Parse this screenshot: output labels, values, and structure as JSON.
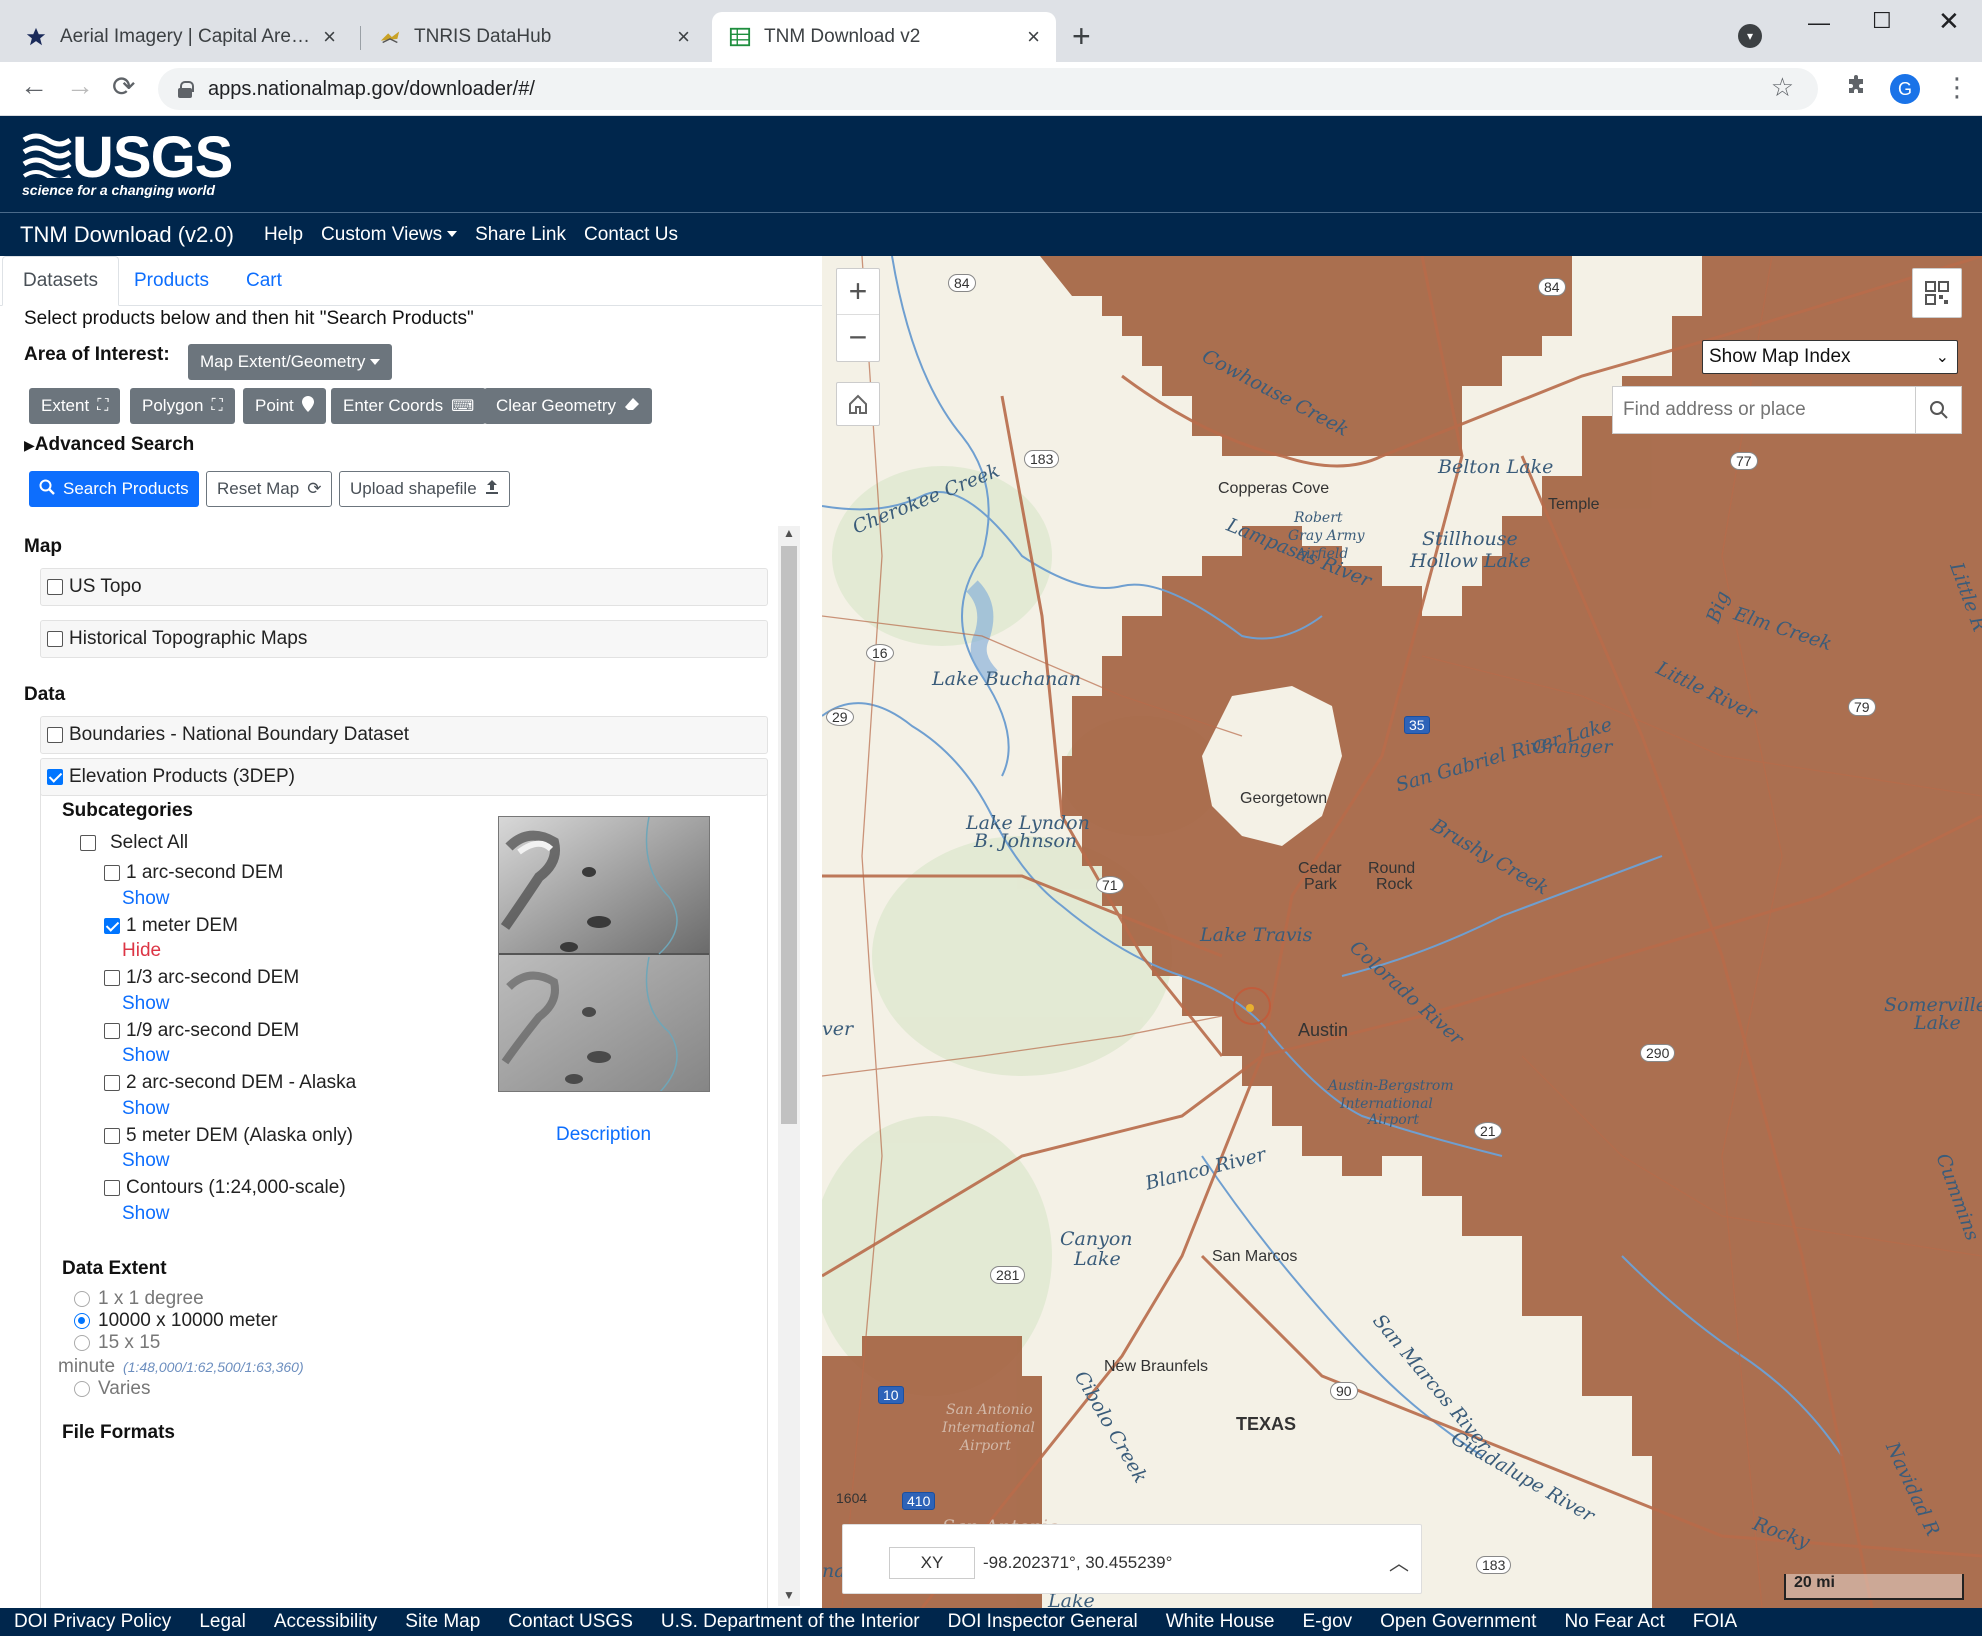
{
  "browser": {
    "tabs": [
      {
        "title": "Aerial Imagery | Capital Area Cou",
        "icon": "star-icon"
      },
      {
        "title": "TNRIS DataHub",
        "icon": "tnris-icon"
      },
      {
        "title": "TNM Download v2",
        "icon": "tnm-icon"
      }
    ],
    "new_tab": "+",
    "url": "apps.nationalmap.gov/downloader/#/",
    "profile_initial": "G"
  },
  "usgs": {
    "logo_word": "USGS",
    "tagline": "science for a changing world"
  },
  "nav": {
    "brand": "TNM Download (v2.0)",
    "links": [
      "Help",
      "Custom Views",
      "Share Link",
      "Contact Us"
    ]
  },
  "panel": {
    "tabs": [
      "Datasets",
      "Products",
      "Cart"
    ],
    "instruction": "Select products below and then hit \"Search Products\"",
    "aoi_label": "Area of Interest:",
    "aoi_dropdown": "Map Extent/Geometry",
    "geo_buttons": [
      "Extent",
      "Polygon",
      "Point",
      "Enter Coords",
      "Clear Geometry"
    ],
    "advanced_search": "Advanced Search",
    "search_button": "Search Products",
    "reset_button": "Reset Map",
    "upload_button": "Upload shapefile",
    "sections": {
      "map": "Map",
      "data": "Data",
      "subcategories": "Subcategories",
      "data_extent": "Data Extent",
      "file_formats": "File Formats"
    },
    "map_items": [
      {
        "label": "US Topo",
        "checked": false
      },
      {
        "label": "Historical Topographic Maps",
        "checked": false
      }
    ],
    "data_items": [
      {
        "label": "Boundaries - National Boundary Dataset",
        "checked": false
      },
      {
        "label": "Elevation Products (3DEP)",
        "checked": true
      }
    ],
    "select_all": "Select All",
    "subcategory_items": [
      {
        "label": "1 arc-second DEM",
        "checked": false,
        "toggle": "Show"
      },
      {
        "label": "1 meter DEM",
        "checked": true,
        "toggle": "Hide"
      },
      {
        "label": "1/3 arc-second DEM",
        "checked": false,
        "toggle": "Show"
      },
      {
        "label": "1/9 arc-second DEM",
        "checked": false,
        "toggle": "Show"
      },
      {
        "label": "2 arc-second DEM - Alaska",
        "checked": false,
        "toggle": "Show"
      },
      {
        "label": "5 meter DEM (Alaska only)",
        "checked": false,
        "toggle": "Show"
      },
      {
        "label": "Contours (1:24,000-scale)",
        "checked": false,
        "toggle": "Show"
      }
    ],
    "description_link": "Description",
    "extent_options": [
      {
        "label": "1 x 1 degree",
        "selected": false,
        "enabled": false
      },
      {
        "label": "10000 x 10000 meter",
        "selected": true,
        "enabled": true
      },
      {
        "label": "15 x 15",
        "selected": false,
        "enabled": false
      },
      {
        "label": "Varies",
        "selected": false,
        "enabled": false
      }
    ],
    "extent_minute": "minute",
    "extent_scale_note": "(1:48,000/1:62,500/1:63,360)"
  },
  "map": {
    "index_select": "Show Map Index",
    "search_placeholder": "Find address or place",
    "coord_mode": "XY",
    "coordinates": "-98.202371°, 30.455239°",
    "scale": "20 mi",
    "labels": {
      "cowhouse": "Cowhouse Creek",
      "belton": "Belton Lake",
      "copperas": "Copperas Cove",
      "temple": "Temple",
      "robert": "Robert",
      "gray_army": "Gray Army",
      "airfield": "Airfield",
      "stillhouse": "Stillhouse",
      "hollow": "Hollow Lake",
      "lampasas": "Lampasas River",
      "cherokee": "Cherokee Creek",
      "buchanan": "Lake Buchanan",
      "elm": "Elm Creek",
      "little_river": "Little River",
      "big": "Big",
      "little_r": "Little R",
      "granger": "Granger",
      "sangabriel": "San Gabriel River Lake",
      "georgetown": "Georgetown",
      "lyndon1": "Lake Lyndon",
      "lyndon2": "B. Johnson",
      "cedar1": "Cedar",
      "cedar2": "Park",
      "round1": "Round",
      "round2": "Rock",
      "brushy": "Brushy Creek",
      "travis": "Lake Travis",
      "colorado": "Colorado River",
      "austin": "Austin",
      "somerville1": "Somerville",
      "somerville2": "Lake",
      "bergstrom1": "Austin-Bergstrom",
      "bergstrom2": "International",
      "bergstrom3": "Airport",
      "blanco": "Blanco River",
      "canyon1": "Canyon",
      "canyon2": "Lake",
      "sanmarcos": "San Marcos",
      "cummins": "Cummins",
      "newbraunfels": "New Braunfels",
      "sanmarcos_river": "San Marcos River",
      "sa1": "San Antonio",
      "sa2": "International",
      "sa3": "Airport",
      "cibolo": "Cibolo Creek",
      "texas": "TEXAS",
      "guadalupe": "Guadalupe River",
      "rocky": "Rocky",
      "navidad": "Navidad R",
      "sanantonio": "San Antonio",
      "ver": "ver",
      "na": "na",
      "lake_b": "Lake"
    },
    "highway_shields": [
      "84",
      "84",
      "183",
      "77",
      "16",
      "35",
      "79",
      "29",
      "71",
      "290",
      "21",
      "281",
      "90",
      "10",
      "410",
      "183",
      "1604"
    ]
  },
  "footer": {
    "links": [
      "DOI Privacy Policy",
      "Legal",
      "Accessibility",
      "Site Map",
      "Contact USGS",
      "U.S. Department of the Interior",
      "DOI Inspector General",
      "White House",
      "E-gov",
      "Open Government",
      "No Fear Act",
      "FOIA"
    ]
  },
  "colors": {
    "usgs_navy": "#00264c",
    "coverage_brown": "#a3613f",
    "primary_blue": "#0d6efd",
    "hide_red": "#dc3545"
  }
}
